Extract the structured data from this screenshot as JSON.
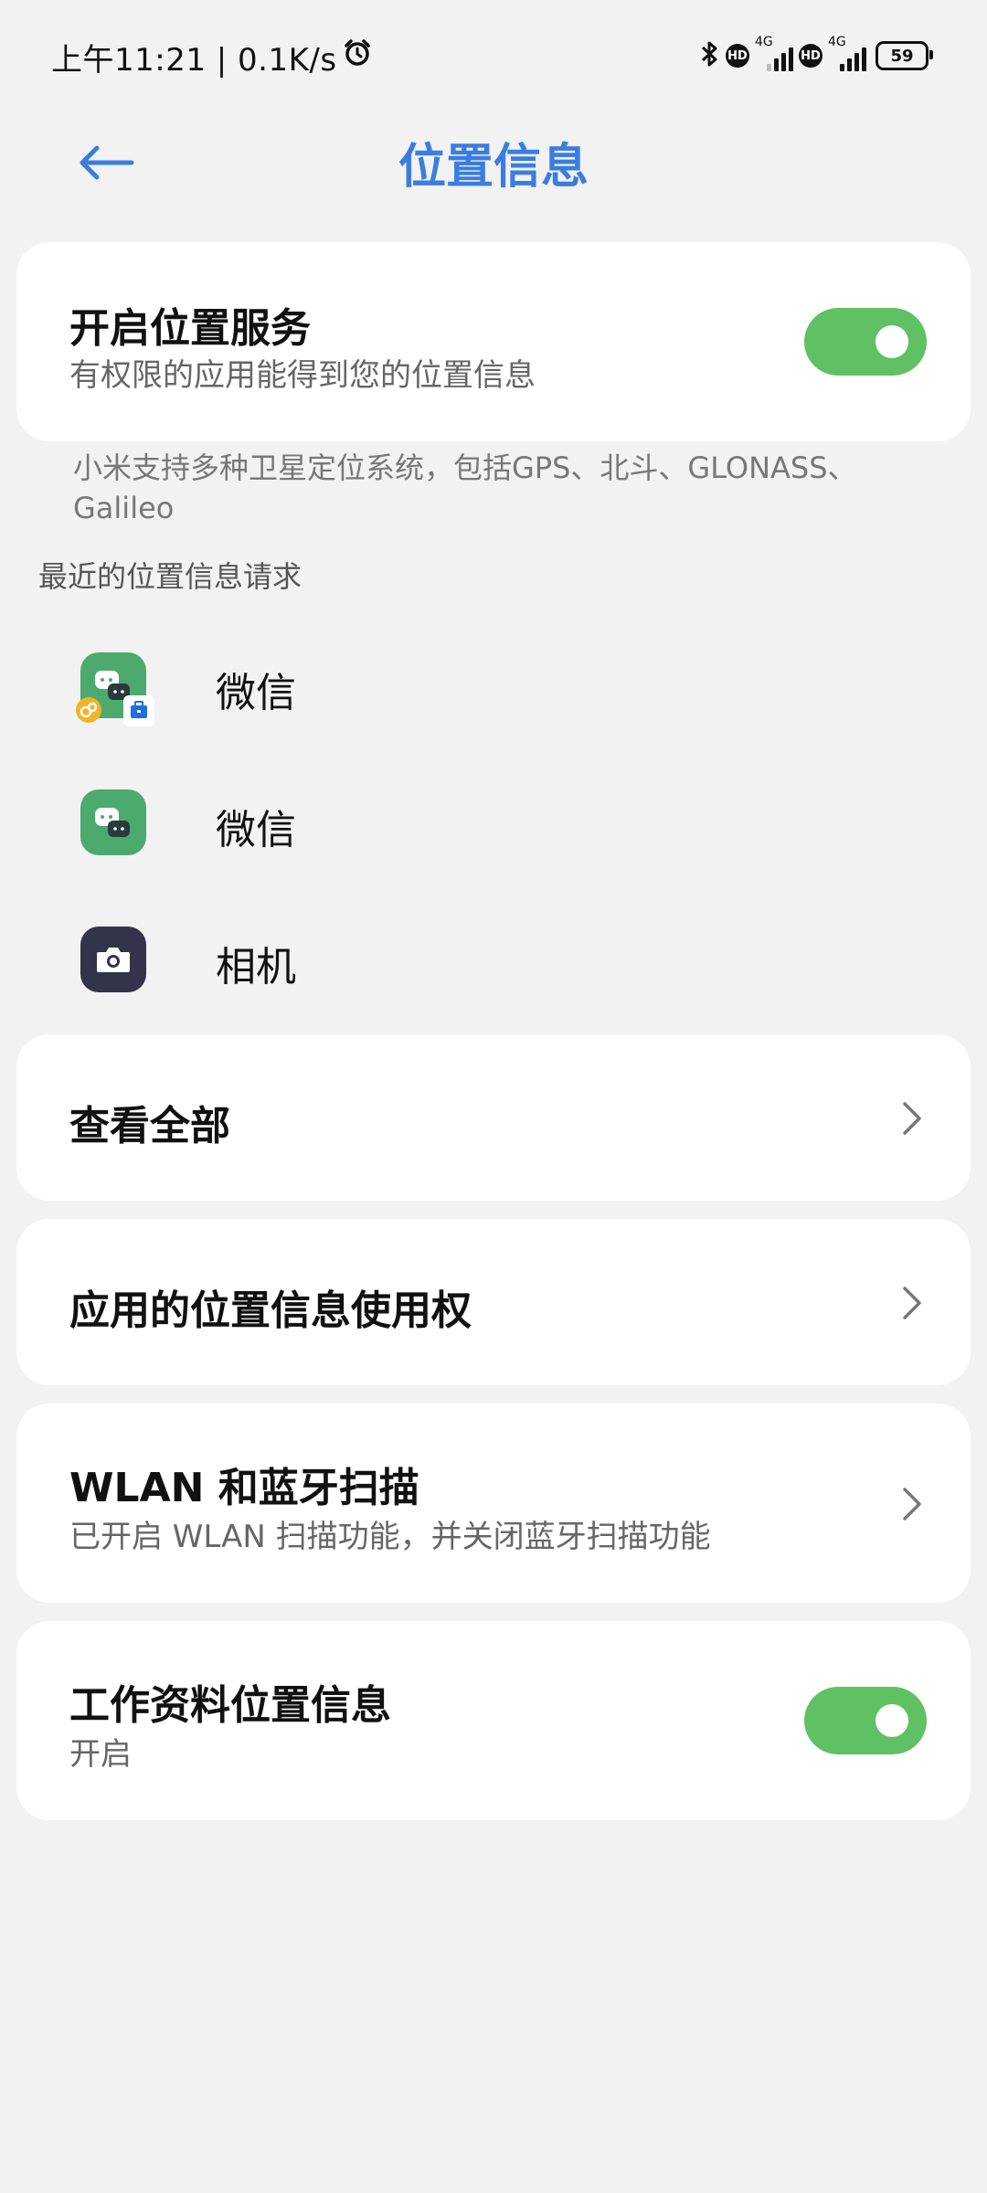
{
  "status_bar": {
    "time_speed": "上午11:21 | 0.1K/s",
    "network_1": "4G",
    "network_2": "4G",
    "hd_1": "HD",
    "hd_2": "HD",
    "battery": "59"
  },
  "header": {
    "title": "位置信息"
  },
  "location_service": {
    "title": "开启位置服务",
    "subtitle": "有权限的应用能得到您的位置信息",
    "enabled": true
  },
  "note": "小米支持多种卫星定位系统，包括GPS、北斗、GLONASS、Galileo",
  "recent_requests": {
    "label": "最近的位置信息请求",
    "apps": [
      {
        "name": "微信",
        "icon": "wechat-work-icon"
      },
      {
        "name": "微信",
        "icon": "wechat-icon"
      },
      {
        "name": "相机",
        "icon": "camera-icon"
      }
    ]
  },
  "view_all": {
    "title": "查看全部"
  },
  "app_permissions": {
    "title": "应用的位置信息使用权"
  },
  "wlan_bt_scan": {
    "title": "WLAN 和蓝牙扫描",
    "subtitle": "已开启 WLAN 扫描功能，并关闭蓝牙扫描功能"
  },
  "work_profile": {
    "title": "工作资料位置信息",
    "subtitle": "开启",
    "enabled": true
  },
  "colors": {
    "accent": "#3a7de0",
    "toggle_on": "#5fc163",
    "background": "#f2f2f2",
    "card": "#ffffff"
  }
}
